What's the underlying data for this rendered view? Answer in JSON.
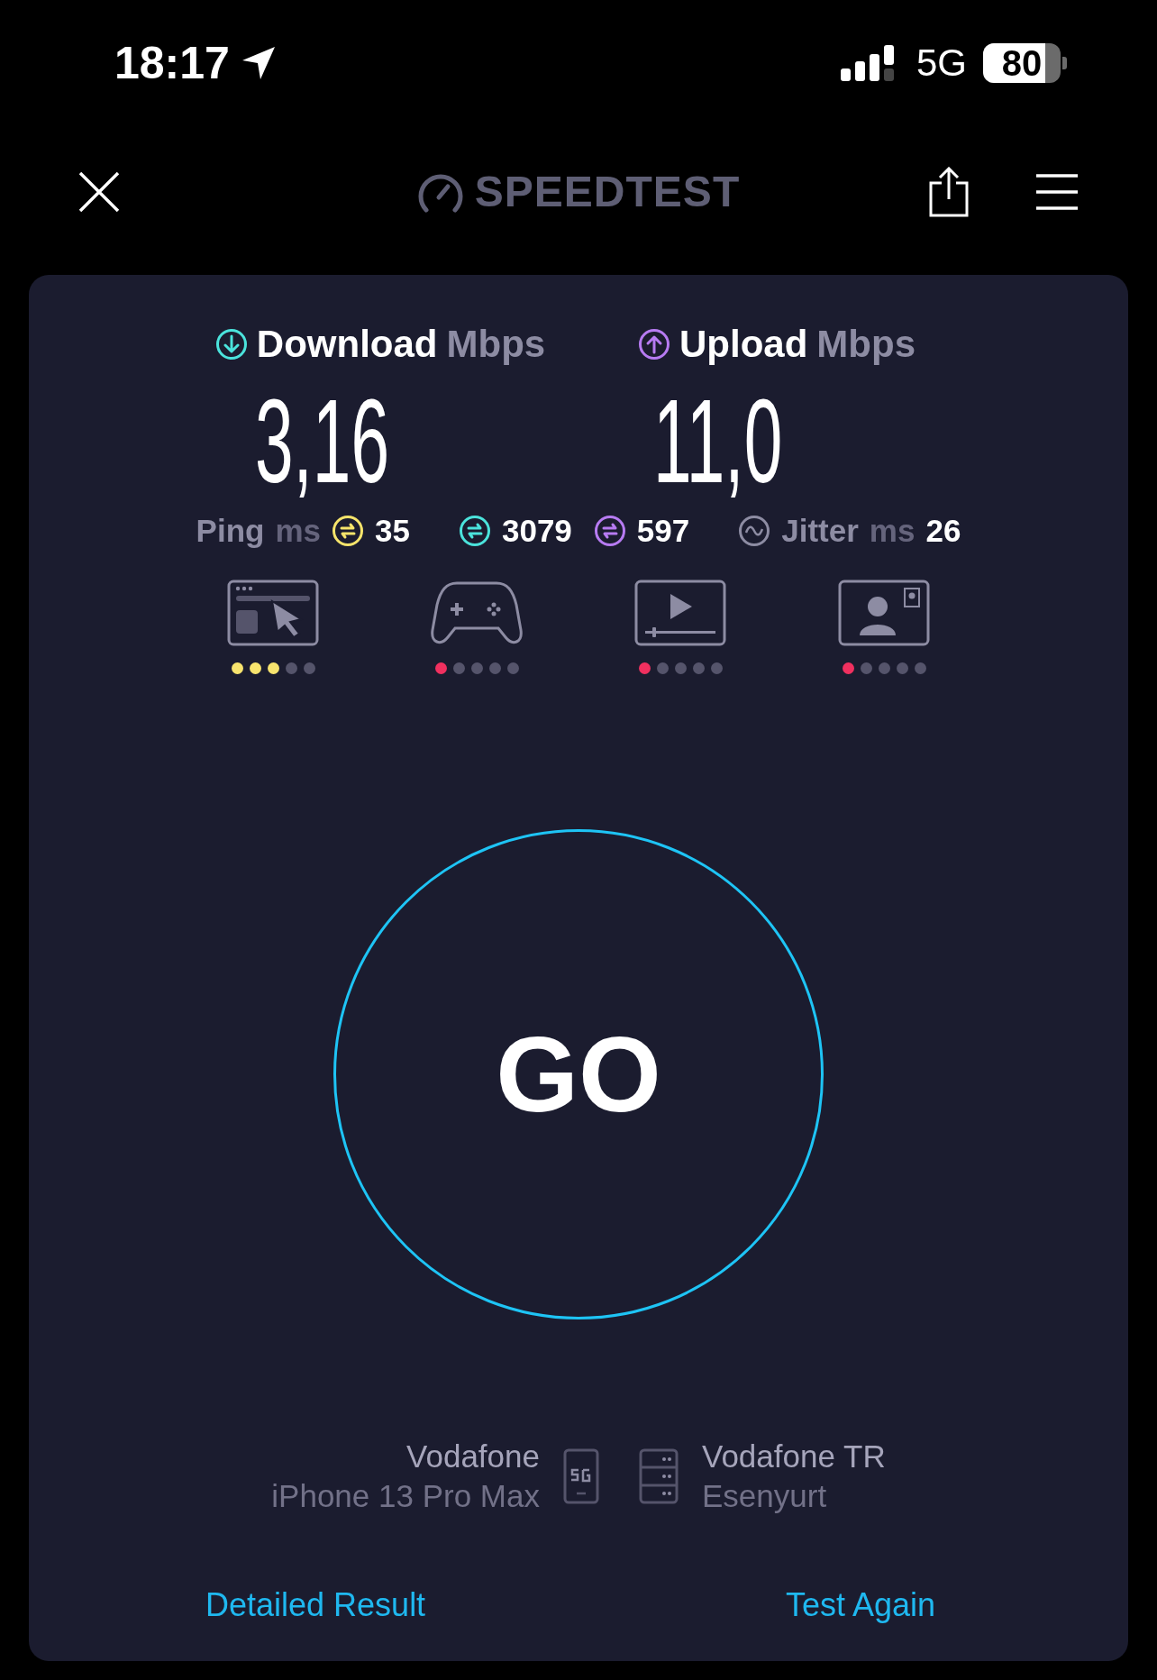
{
  "status_bar": {
    "time": "18:17",
    "network": "5G",
    "battery": "80"
  },
  "header": {
    "logo": "SPEEDTEST"
  },
  "results": [
    {
      "kind": "download",
      "label": "Download",
      "unit": "Mbps",
      "value": "3,16"
    },
    {
      "kind": "upload",
      "label": "Upload",
      "unit": "Mbps",
      "value": "11,0"
    }
  ],
  "latency": {
    "ping_label": "Ping",
    "ping_unit": "ms",
    "ping_idle": "35",
    "ping_download": "3079",
    "ping_upload": "597",
    "jitter_label": "Jitter",
    "jitter_unit": "ms",
    "jitter": "26"
  },
  "quality": [
    {
      "kind": "browsing",
      "stars": 3,
      "color": "#f8e46e"
    },
    {
      "kind": "gaming",
      "stars": 1,
      "color": "#f0305f"
    },
    {
      "kind": "streaming",
      "stars": 1,
      "color": "#f0305f"
    },
    {
      "kind": "video-call",
      "stars": 1,
      "color": "#f0305f"
    }
  ],
  "go_button": "GO",
  "provider": {
    "name": "Vodafone",
    "device": "iPhone 13 Pro Max"
  },
  "server": {
    "name": "Vodafone TR",
    "location": "Esenyurt"
  },
  "links": [
    "Detailed Result",
    "Test Again"
  ]
}
